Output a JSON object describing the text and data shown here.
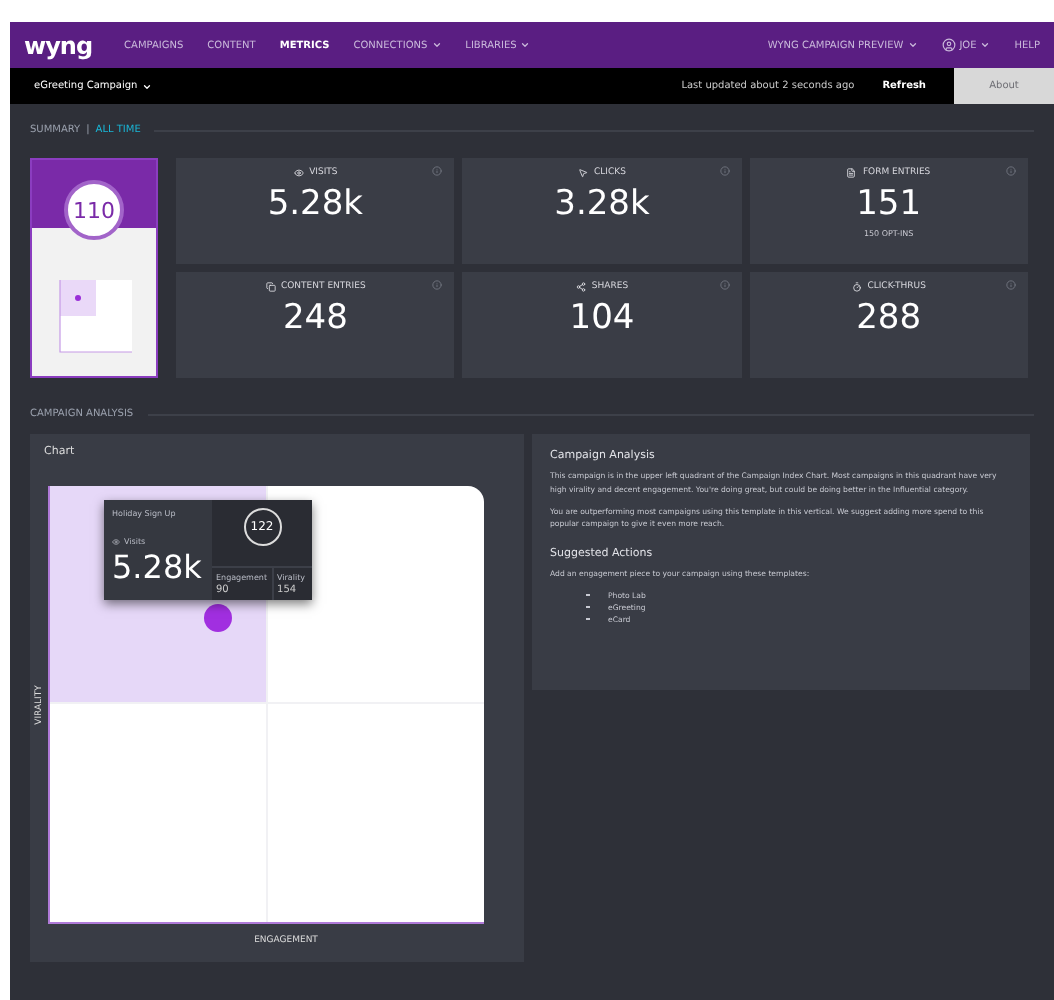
{
  "nav": {
    "logo": "wyng",
    "items": [
      {
        "label": "CAMPAIGNS",
        "selected": false,
        "dropdown": false
      },
      {
        "label": "CONTENT",
        "selected": false,
        "dropdown": false
      },
      {
        "label": "METRICS",
        "selected": true,
        "dropdown": false
      },
      {
        "label": "CONNECTIONS",
        "selected": false,
        "dropdown": true
      },
      {
        "label": "LIBRARIES",
        "selected": false,
        "dropdown": true
      }
    ],
    "right": [
      {
        "kind": "menu",
        "label": "WYNG CAMPAIGN PREVIEW",
        "dropdown": true
      },
      {
        "kind": "user",
        "label": "JOE",
        "dropdown": true
      },
      {
        "kind": "link",
        "label": "HELP",
        "dropdown": false
      }
    ]
  },
  "subbar": {
    "campaign": "eGreeting Campaign",
    "updated": "Last updated about 2 seconds ago",
    "refresh": "Refresh",
    "button": "About"
  },
  "summary": {
    "title": "SUMMARY",
    "separator": "|",
    "range": "ALL TIME"
  },
  "thumbnail": {
    "score": "110"
  },
  "stats": [
    {
      "kind": "visits",
      "label": "VISITS",
      "value": "5.28k"
    },
    {
      "kind": "clicks",
      "label": "CLICKS",
      "value": "3.28k"
    },
    {
      "kind": "form",
      "label": "FORM ENTRIES",
      "value": "151",
      "note": "150 OPT-INS"
    },
    {
      "kind": "content",
      "label": "CONTENT ENTRIES",
      "value": "248"
    },
    {
      "kind": "shares",
      "label": "SHARES",
      "value": "104"
    },
    {
      "kind": "clickthrus",
      "label": "CLICK-THRUS",
      "value": "288"
    }
  ],
  "analysis_section": "CAMPAIGN ANALYSIS",
  "chart": {
    "title": "Chart",
    "xlabel": "ENGAGEMENT",
    "ylabel": "VIRALITY",
    "tooltip": {
      "name": "Holiday Sign Up",
      "metric": "Visits",
      "value": "5.28k",
      "score": "122",
      "engagement_label": "Engagement",
      "engagement": "90",
      "virality_label": "Virality",
      "virality": "154"
    }
  },
  "analysis": {
    "title": "Campaign Analysis",
    "paragraphs": [
      "This campaign is in the upper left quadrant of the Campaign Index Chart. Most campaigns in this quadrant have very high virality and decent engagement. You're doing great, but could be doing better in the Influential category.",
      "You are outperforming most campaigns using this template in this vertical. We suggest adding more spend to this popular campaign to give it even more reach."
    ],
    "actions_title": "Suggested Actions",
    "actions_intro": "Add an engagement piece to your campaign using these templates:",
    "templates": [
      "Photo Lab",
      "eGreeting",
      "eCard"
    ]
  }
}
